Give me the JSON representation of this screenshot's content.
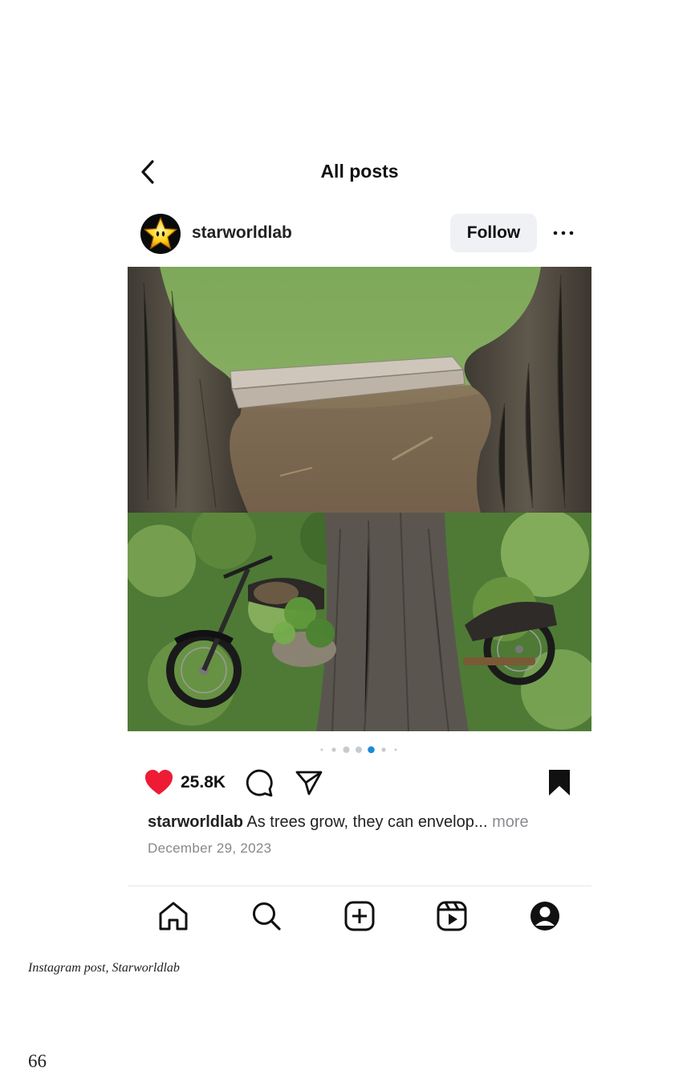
{
  "header": {
    "title": "All posts"
  },
  "post": {
    "username": "starworldlab",
    "follow_label": "Follow",
    "likes": "25.8K",
    "caption_user": "starworldlab",
    "caption_text": " As trees grow, they can envelop... ",
    "caption_more": "more",
    "date": "December 29, 2023",
    "carousel": {
      "total": 7,
      "active_index": 4
    }
  },
  "colors": {
    "like_red": "#ed1b34",
    "dot_active": "#1a8cd8",
    "follow_bg": "#eff1f4"
  },
  "icons": [
    "back-arrow-icon",
    "star-avatar-icon",
    "more-dots-icon",
    "heart-icon",
    "comment-icon",
    "share-icon",
    "bookmark-icon",
    "home-icon",
    "search-icon",
    "create-icon",
    "reels-icon",
    "profile-icon"
  ],
  "page": {
    "caption": "Instagram post, Starworldlab",
    "number": "66"
  }
}
